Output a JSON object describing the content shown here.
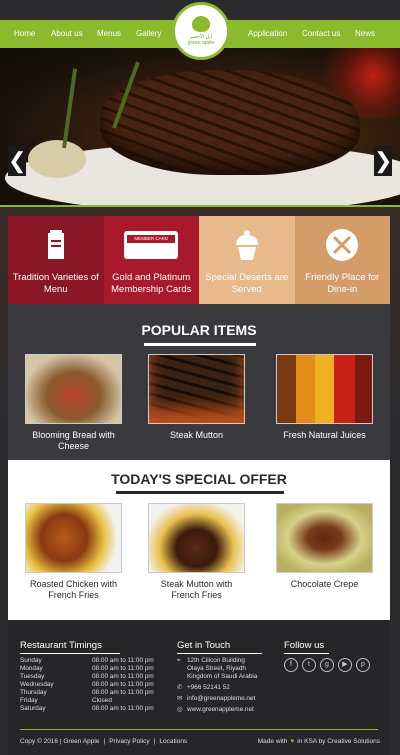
{
  "nav": {
    "items": [
      "Home",
      "About us",
      "Menus",
      "Gallery",
      "Application",
      "Contact us",
      "News"
    ],
    "logo_line1": "أبل الأخضر",
    "logo_line2": "green apple"
  },
  "hero": {
    "prev": "❮",
    "next": "❯"
  },
  "features": [
    {
      "label": "Tradition Varieties  of Menu",
      "bg": "#8b1626",
      "icon": "menu-book-icon"
    },
    {
      "label": "Gold and Platinum Membership Cards",
      "bg": "#a8192c",
      "icon": "member-card-icon",
      "card_text": "MEMBER CARD"
    },
    {
      "label": "Special Deserts are Served",
      "bg": "#e7b98b",
      "icon": "cupcake-icon"
    },
    {
      "label": "Friendly Place for Dine-in",
      "bg": "#d39c68",
      "icon": "fork-knife-icon"
    }
  ],
  "popular": {
    "title": "POPULAR ITEMS",
    "items": [
      "Blooming Bread with Cheese",
      "Steak Mutton",
      "Fresh Natural Juices"
    ]
  },
  "special": {
    "title": "TODAY'S SPECIAL OFFER",
    "items": [
      "Roasted Chicken with French Fries",
      "Steak Mutton with French Fries",
      "Chocolate Crepe"
    ]
  },
  "footer": {
    "timings_title": "Restaurant Timings",
    "timings": [
      {
        "day": "Sunday",
        "hours": "08:00 am to 11:00 pm"
      },
      {
        "day": "Monday",
        "hours": "08:00 am to 11:00 pm"
      },
      {
        "day": "Tuesday",
        "hours": "08:00 am to 11:00 pm"
      },
      {
        "day": "Wednesday",
        "hours": "08:00 am to 11:00 pm"
      },
      {
        "day": "Thursday",
        "hours": "08:00 am to 11:00 pm"
      },
      {
        "day": "Friday",
        "hours": "Closed"
      },
      {
        "day": "Saturday",
        "hours": "08:00 am to 11:00 pm"
      }
    ],
    "contact_title": "Get in Touch",
    "address": "12th Cilicon Building\nOlaya Street, Riyadh\nKingdom of Saudi Arabia",
    "phone": "+966 52141 52",
    "email": "info@greenappleme.net",
    "website": "www.greenappleme.net",
    "follow_title": "Follow us",
    "social": [
      "facebook-icon",
      "twitter-icon",
      "google-plus-icon",
      "youtube-icon",
      "pinterest-icon"
    ],
    "copyright": "Copy  ©  2016 | Green Apple",
    "privacy": "Privacy Policy",
    "locations": "Locations",
    "made_with": "Made with",
    "in_ksa": "in KSA by Creative Solutions"
  },
  "colors": {
    "accent": "#8cba2e",
    "dark": "#3a3a3e",
    "footer": "#262628",
    "ruby": "#a8192c"
  }
}
